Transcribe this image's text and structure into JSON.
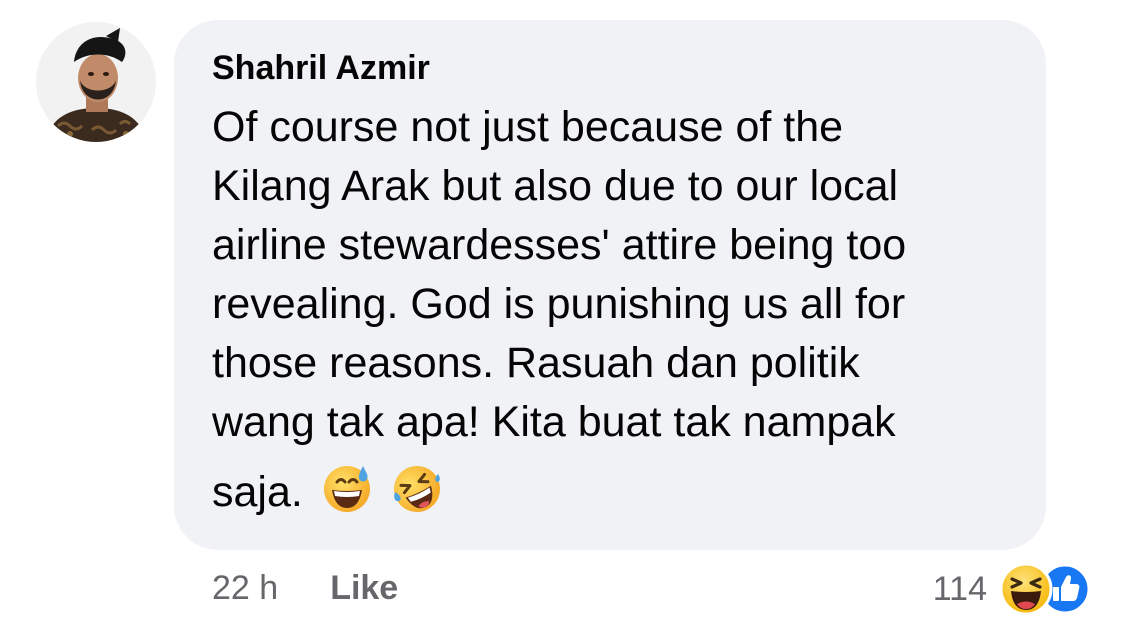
{
  "comment": {
    "author": "Shahril Azmir",
    "lines": [
      "Of course not just because of the",
      "Kilang Arak but also due to our local",
      "airline stewardesses' attire being too",
      "revealing. God is punishing us all for",
      "those reasons. Rasuah dan politik",
      "wang tak apa! Kita buat tak nampak"
    ],
    "last_line": "saja.",
    "emojis": [
      "grinning-sweat-emoji",
      "rolling-on-floor-laughing-emoji"
    ]
  },
  "actions": {
    "timestamp": "22 h",
    "like_label": "Like"
  },
  "reactions": {
    "count": "114",
    "icons": [
      "haha-reaction-icon",
      "like-reaction-icon"
    ]
  },
  "colors": {
    "bubble": "#f0f2f5",
    "text": "#050505",
    "secondary": "#65676b",
    "like_blue": "#1877f2",
    "emoji_yellow": "#f7b500"
  }
}
